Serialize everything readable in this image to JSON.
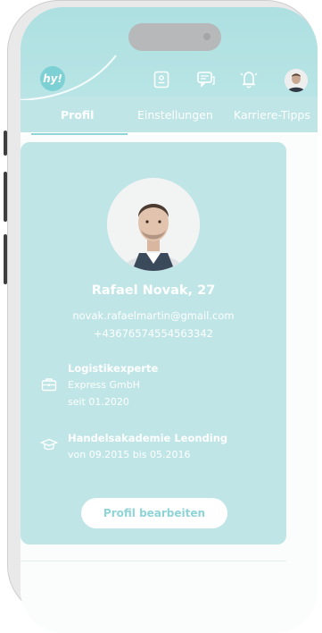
{
  "app": {
    "logo_text": "hy!",
    "colors": {
      "primary": "#8fd4d6",
      "card": "#bfe5e6",
      "header": "#aee0e1"
    },
    "header_icons": [
      "document-icon",
      "chat-icon",
      "bell-icon",
      "profile-avatar"
    ]
  },
  "tabs": [
    {
      "label": "Profil",
      "active": true
    },
    {
      "label": "Einstellungen",
      "active": false
    },
    {
      "label": "Karriere-Tipps",
      "active": false
    }
  ],
  "profile": {
    "name": "Rafael Novak, 27",
    "email": "novak.rafaelmartin@gmail.com",
    "phone": "+4367657455456334​2",
    "job": {
      "title": "Logistikexperte",
      "company": "Express GmbH",
      "since": "seit 01.2020",
      "icon": "briefcase-icon"
    },
    "education": {
      "school": "Handelsakademie Leonding",
      "period": "von 09.2015 bis 05.2016",
      "icon": "graduation-cap-icon"
    },
    "edit_label": "Profil bearbeiten"
  }
}
